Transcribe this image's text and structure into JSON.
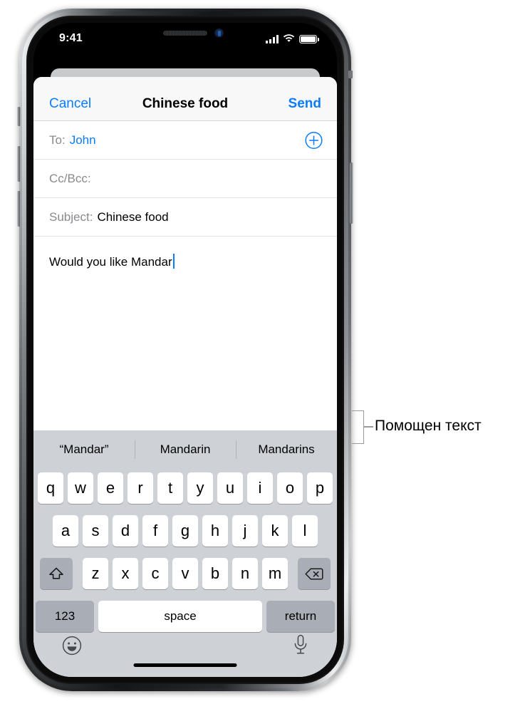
{
  "status_bar": {
    "time": "9:41",
    "signal_icon": "cellular-bars-icon",
    "wifi_icon": "wifi-icon",
    "battery_icon": "battery-full-icon"
  },
  "compose_sheet": {
    "cancel_label": "Cancel",
    "title": "Chinese food",
    "send_label": "Send",
    "fields": [
      {
        "label": "To:",
        "value": "John",
        "is_link": true
      },
      {
        "label": "Cc/Bcc:",
        "value": "",
        "is_link": false
      },
      {
        "label": "Subject:",
        "value": "Chinese food",
        "is_link": false
      }
    ],
    "add_recipient_icon": "plus-circle-icon",
    "body_text": "Would you like Mandar"
  },
  "predictive_bar": {
    "suggestions": [
      "“Mandar”",
      "Mandarin",
      "Mandarins"
    ]
  },
  "keyboard": {
    "row1": [
      "q",
      "w",
      "e",
      "r",
      "t",
      "y",
      "u",
      "i",
      "o",
      "p"
    ],
    "row2": [
      "a",
      "s",
      "d",
      "f",
      "g",
      "h",
      "j",
      "k",
      "l"
    ],
    "row3": [
      "z",
      "x",
      "c",
      "v",
      "b",
      "n",
      "m"
    ],
    "shift_icon": "shift-arrow-icon",
    "delete_icon": "backspace-delete-icon",
    "numbers_label": "123",
    "space_label": "space",
    "return_label": "return",
    "emoji_icon": "smiley-face-icon",
    "dictation_icon": "microphone-icon"
  },
  "annotation": {
    "callout_label": "Помощен текст"
  },
  "colors": {
    "accent_blue": "#0a7cff",
    "keyboard_background": "#ced2d7",
    "function_key": "#a8adb6",
    "callout_gray": "#9a9a9a"
  }
}
